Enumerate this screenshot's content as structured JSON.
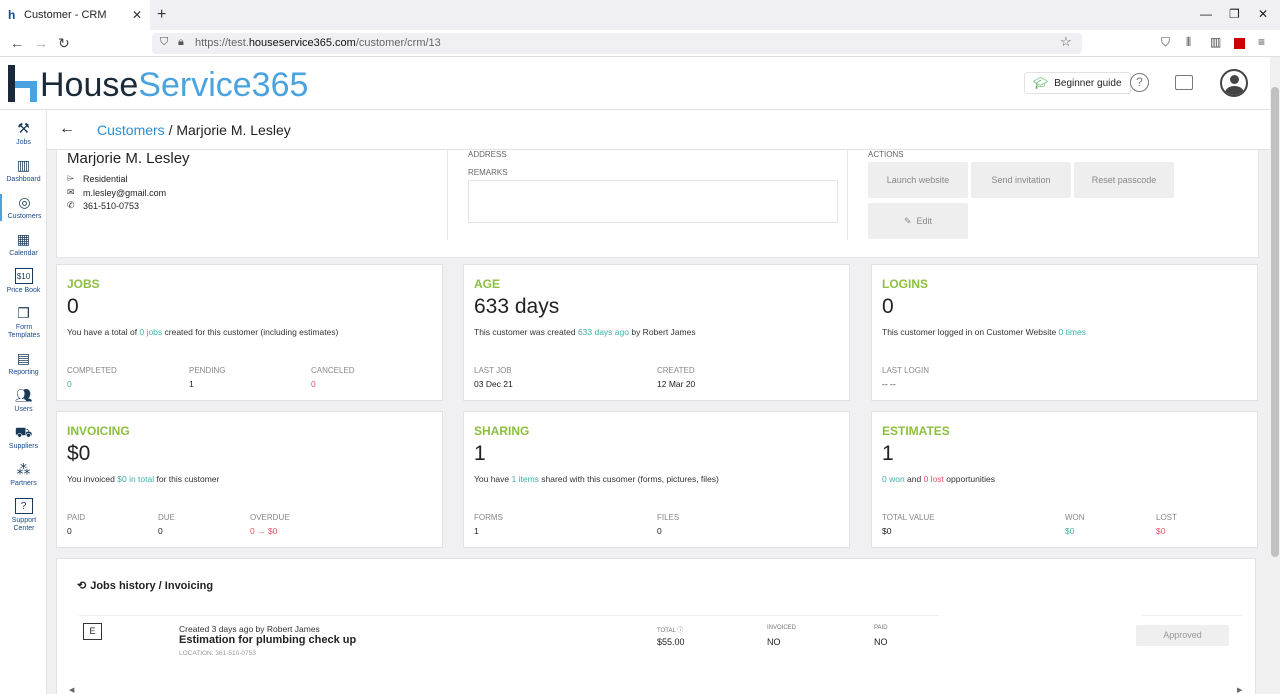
{
  "browser": {
    "tab_title": "Customer - CRM",
    "url_prefix": "https://test.",
    "url_domain": "houseservice365.com",
    "url_path": "/customer/crm/13"
  },
  "header": {
    "logo_part1": "House",
    "logo_part2": "Service365",
    "guide_label": "Beginner guide"
  },
  "sidebar": {
    "items": [
      {
        "label": "Jobs",
        "icon": "tools-icon"
      },
      {
        "label": "Dashboard",
        "icon": "chart-icon"
      },
      {
        "label": "Customers",
        "icon": "customers-icon"
      },
      {
        "label": "Calendar",
        "icon": "calendar-icon"
      },
      {
        "label": "Price Book",
        "icon": "price-icon"
      },
      {
        "label": "Form Templates",
        "icon": "form-icon"
      },
      {
        "label": "Reporting",
        "icon": "report-icon"
      },
      {
        "label": "Users",
        "icon": "users-icon"
      },
      {
        "label": "Suppliers",
        "icon": "truck-icon"
      },
      {
        "label": "Partners",
        "icon": "partners-icon"
      },
      {
        "label": "Support Center",
        "icon": "help-icon"
      }
    ]
  },
  "breadcrumb": {
    "parent": "Customers",
    "separator": " / ",
    "current": "Marjorie M. Lesley"
  },
  "customer": {
    "name": "Marjorie M. Lesley",
    "type": "Residential",
    "email": "m.lesley@gmail.com",
    "phone": "361-510-0753",
    "address_label": "ADDRESS",
    "remarks_label": "REMARKS",
    "actions_label": "ACTIONS",
    "actions": {
      "launch": "Launch website",
      "invite": "Send invitation",
      "reset": "Reset passcode",
      "edit": "Edit"
    }
  },
  "cards": {
    "jobs": {
      "title": "JOBS",
      "value": "0",
      "desc_a": "You have a total of ",
      "desc_hl": "0 jobs",
      "desc_b": " created for this customer (including estimates)",
      "s1_label": "COMPLETED",
      "s1_value": "0",
      "s2_label": "PENDING",
      "s2_value": "1",
      "s3_label": "CANCELED",
      "s3_value": "0"
    },
    "age": {
      "title": "AGE",
      "value": "633 days",
      "desc_a": "This customer was created ",
      "desc_hl": "633 days ago",
      "desc_b": " by Robert James",
      "s1_label": "LAST JOB",
      "s1_value": "03 Dec 21",
      "s2_label": "CREATED",
      "s2_value": "12 Mar 20"
    },
    "logins": {
      "title": "LOGINS",
      "value": "0",
      "desc_a": "This customer logged in on Customer Website ",
      "desc_hl": "0 times",
      "s1_label": "LAST LOGIN",
      "s1_value": "-- --"
    },
    "invoicing": {
      "title": "INVOICING",
      "value": "$0",
      "desc_a": "You invoiced ",
      "desc_hl": "$0 in total",
      "desc_b": " for this customer",
      "s1_label": "PAID",
      "s1_value": "0",
      "s2_label": "DUE",
      "s2_value": "0",
      "s3_label": "OVERDUE",
      "s3_value": "0 → $0"
    },
    "sharing": {
      "title": "SHARING",
      "value": "1",
      "desc_a": "You have ",
      "desc_hl": "1 items",
      "desc_b": " shared with this cusomer (forms, pictures, files)",
      "s1_label": "FORMS",
      "s1_value": "1",
      "s2_label": "FILES",
      "s2_value": "0"
    },
    "estimates": {
      "title": "ESTIMATES",
      "value": "1",
      "desc_hl": "0 won",
      "desc_mid": " and ",
      "desc_red": "0 lost",
      "desc_b": " opportunities",
      "s1_label": "TOTAL VALUE",
      "s1_value": "$0",
      "s2_label": "WON",
      "s2_value": "$0",
      "s3_label": "LOST",
      "s3_value": "$0"
    }
  },
  "history": {
    "title": "Jobs history / Invoicing",
    "jobs": [
      {
        "badge": "E",
        "created": "Created 3 days ago by Robert James",
        "title": "Estimation for plumbing check up",
        "location": "LOCATION: 361-510-0753",
        "total_label": "TOTAL",
        "total": "$55.00",
        "invoiced_label": "INVOICED",
        "invoiced": "NO",
        "paid_label": "PAID",
        "paid": "NO",
        "status": "Approved"
      }
    ]
  },
  "colors": {
    "accent_blue": "#4aa3df",
    "card_title_green": "#8cbf3f",
    "teal": "#3fb1a6",
    "red": "#e05566"
  }
}
